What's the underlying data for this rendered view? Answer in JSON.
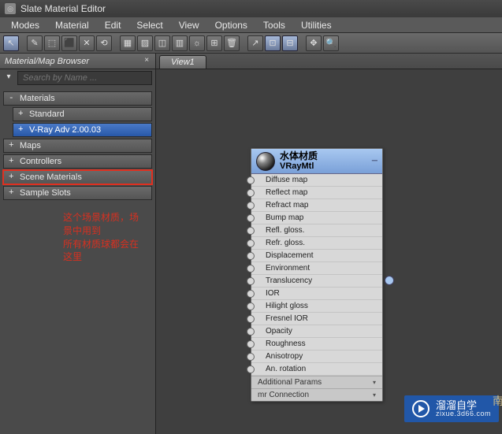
{
  "titlebar": {
    "title": "Slate Material Editor"
  },
  "menubar": {
    "items": [
      "Modes",
      "Material",
      "Edit",
      "Select",
      "View",
      "Options",
      "Tools",
      "Utilities"
    ]
  },
  "toolbar": {
    "buttons": [
      {
        "icon": "↖",
        "name": "select-tool",
        "active": true
      },
      {
        "icon": "✎",
        "name": "pick-tool"
      },
      {
        "icon": "⬚",
        "name": "assign-material"
      },
      {
        "icon": "⬛",
        "name": "assign-selection"
      },
      {
        "icon": "✕",
        "name": "delete"
      },
      {
        "icon": "⟲",
        "name": "reset"
      },
      {
        "icon": "▦",
        "name": "background"
      },
      {
        "icon": "▨",
        "name": "backlight"
      },
      {
        "icon": "◫",
        "name": "sample-type"
      },
      {
        "icon": "▥",
        "name": "preview-options"
      },
      {
        "icon": "☼",
        "name": "show-map"
      },
      {
        "icon": "⊞",
        "name": "show-end-result"
      },
      {
        "icon": "🗑",
        "name": "clear"
      },
      {
        "icon": "↗",
        "name": "move-children"
      },
      {
        "icon": "⊡",
        "name": "layout-all",
        "active": true
      },
      {
        "icon": "⊟",
        "name": "layout-children",
        "active": true
      },
      {
        "icon": "✥",
        "name": "material-map-navigator"
      },
      {
        "icon": "🔍",
        "name": "select-by-material"
      }
    ]
  },
  "browser": {
    "title": "Material/Map Browser",
    "search_placeholder": "Search by Name ...",
    "tree": [
      {
        "label": "Materials",
        "prefix": "-",
        "children": [
          {
            "label": "Standard",
            "prefix": "+"
          },
          {
            "label": "V-Ray Adv 2.00.03",
            "prefix": "+",
            "selected": true
          }
        ]
      },
      {
        "label": "Maps",
        "prefix": "+"
      },
      {
        "label": "Controllers",
        "prefix": "+"
      },
      {
        "label": "Scene Materials",
        "prefix": "+",
        "highlighted": true
      },
      {
        "label": "Sample Slots",
        "prefix": "+"
      }
    ],
    "annotation_line1": "这个场景材质，场景中用到",
    "annotation_line2": "所有材质球都会在这里"
  },
  "viewport": {
    "tab": "View1",
    "node": {
      "title": "水体材质",
      "subtitle": "VRayMtl",
      "slots": [
        "Diffuse map",
        "Reflect map",
        "Refract map",
        "Bump map",
        "Refl. gloss.",
        "Refr. gloss.",
        "Displacement",
        "Environment",
        "Translucency",
        "IOR",
        "Hilight gloss",
        "Fresnel IOR",
        "Opacity",
        "Roughness",
        "Anisotropy",
        "An. rotation"
      ],
      "footer": [
        "Additional Params",
        "mr Connection"
      ]
    }
  },
  "watermark": {
    "cn": "溜溜自学",
    "en": "zixue.3d66.com",
    "side": "南"
  }
}
